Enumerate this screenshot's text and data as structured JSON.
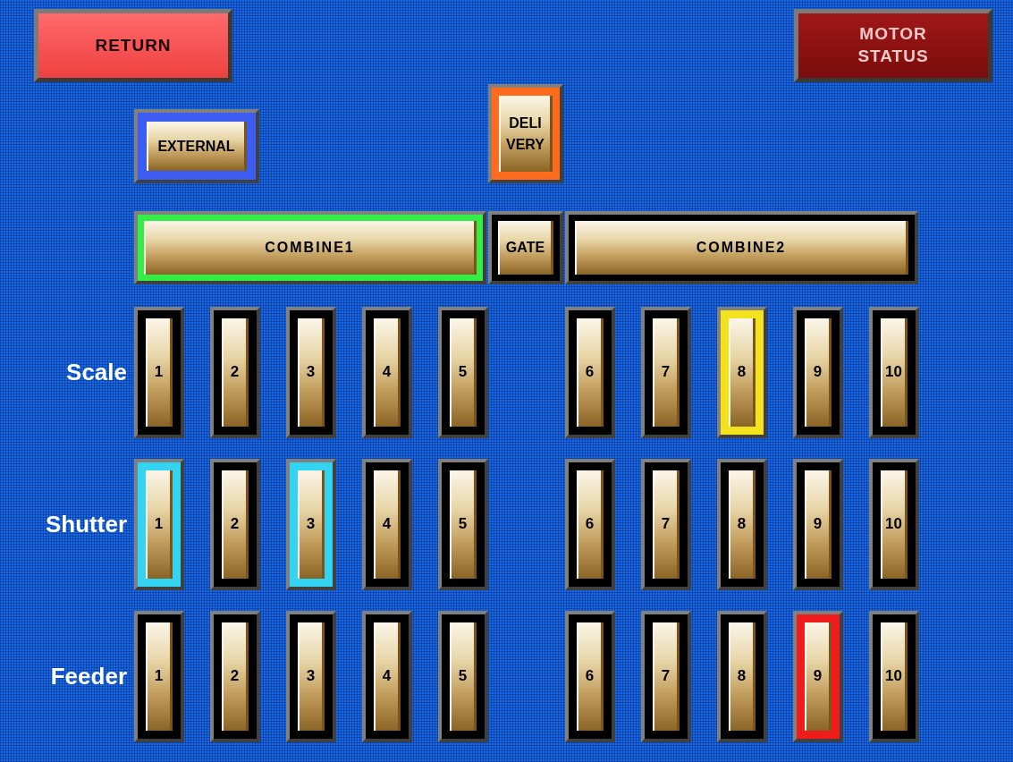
{
  "return_button": {
    "label": "RETURN"
  },
  "motor_status_button": {
    "label": "MOTOR STATUS"
  },
  "mode_buttons": [
    {
      "label": "EXTERNAL",
      "color": "#3d5df2"
    },
    {
      "label": "DELI VERY",
      "color": "#ff6a1c"
    }
  ],
  "sections": [
    {
      "label": "COMBINE1",
      "color": "#33ee44"
    },
    {
      "label": "GATE"
    },
    {
      "label": "COMBINE2"
    }
  ],
  "rows": [
    {
      "label": "Scale",
      "buttons": [
        {
          "label": "1"
        },
        {
          "label": "2"
        },
        {
          "label": "3"
        },
        {
          "label": "4"
        },
        {
          "label": "5"
        },
        {
          "label": "6"
        },
        {
          "label": "7"
        },
        {
          "label": "8",
          "color": "#f5e21e"
        },
        {
          "label": "9"
        },
        {
          "label": "10"
        }
      ]
    },
    {
      "label": "Shutter",
      "buttons": [
        {
          "label": "1",
          "color": "#33d4f2"
        },
        {
          "label": "2"
        },
        {
          "label": "3",
          "color": "#33d4f2"
        },
        {
          "label": "4"
        },
        {
          "label": "5"
        },
        {
          "label": "6"
        },
        {
          "label": "7"
        },
        {
          "label": "8"
        },
        {
          "label": "9"
        },
        {
          "label": "10"
        }
      ]
    },
    {
      "label": "Feeder",
      "buttons": [
        {
          "label": "1"
        },
        {
          "label": "2"
        },
        {
          "label": "3"
        },
        {
          "label": "4"
        },
        {
          "label": "5"
        },
        {
          "label": "6"
        },
        {
          "label": "7"
        },
        {
          "label": "8"
        },
        {
          "label": "9",
          "color": "#f01c1c"
        },
        {
          "label": "10"
        }
      ]
    }
  ]
}
